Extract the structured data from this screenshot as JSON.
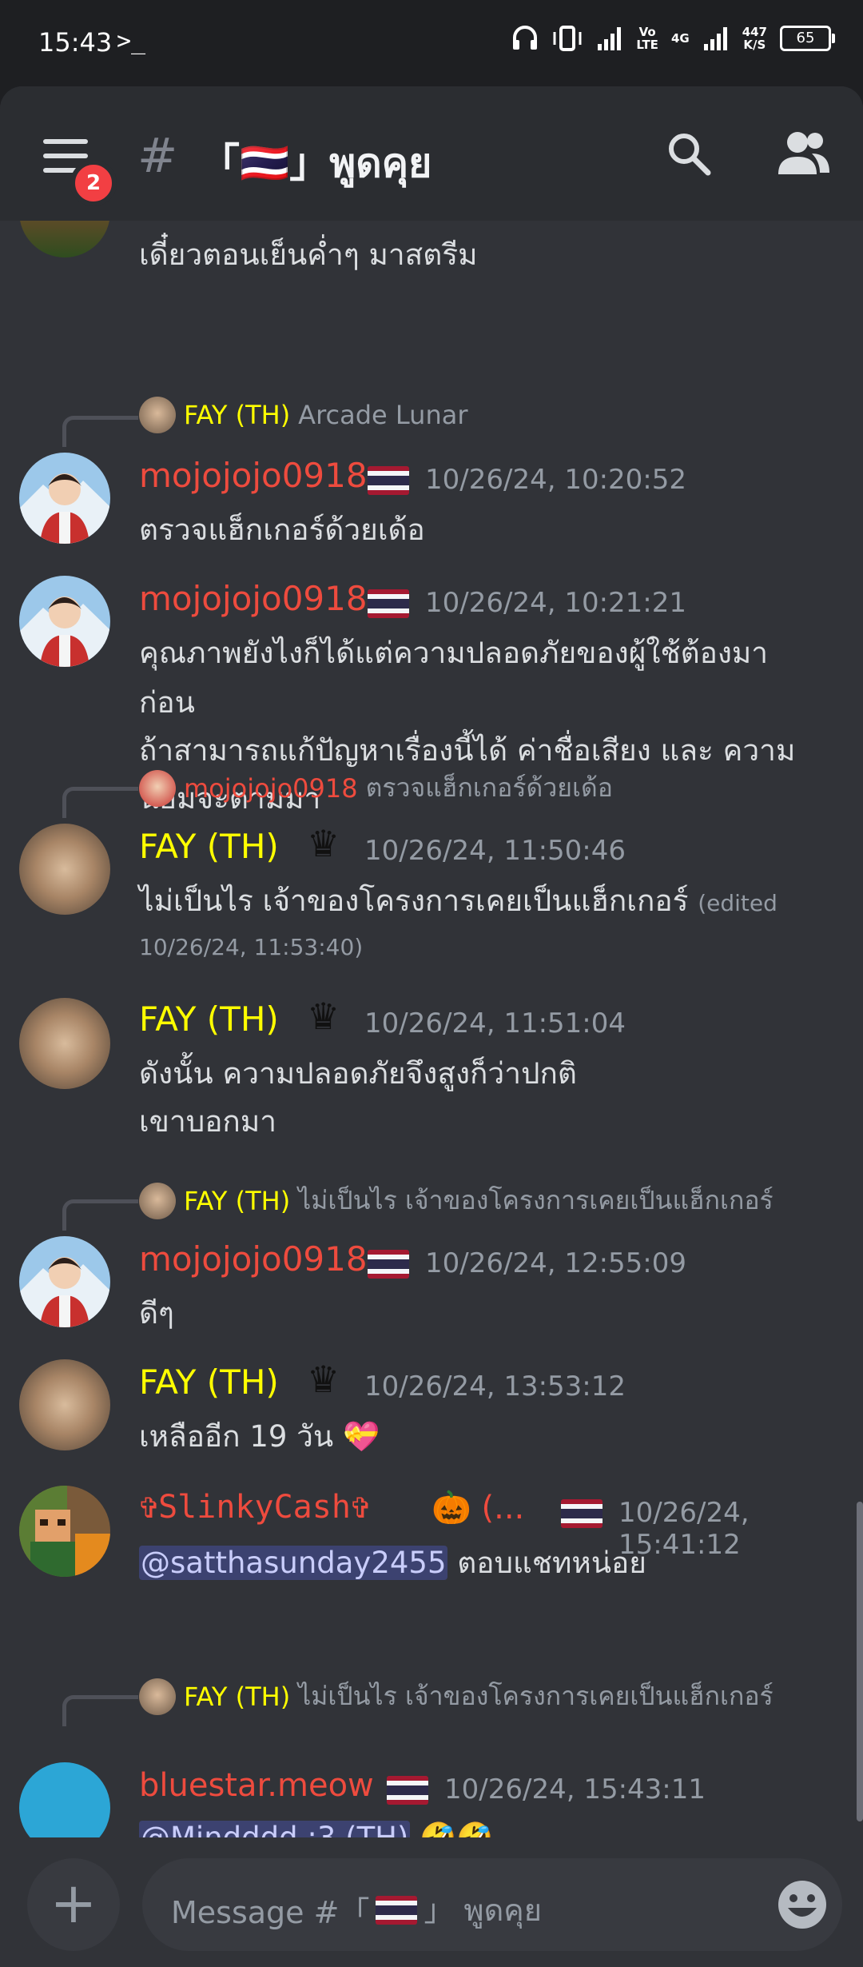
{
  "status_bar": {
    "time": "15:43",
    "terminal_glyph": ">_",
    "network_top": "Vo",
    "network_bottom": "LTE",
    "cell_type": "4G",
    "speed_top": "447",
    "speed_bottom": "K/S",
    "battery": "65"
  },
  "header": {
    "hamburger_badge": "2",
    "hash": "#",
    "channel_name": "「🇹🇭」พูดคุย"
  },
  "messages": {
    "top_partial_text": "เดี๋ยวตอนเย็นค่ำๆ มาสตรีม",
    "m1": {
      "reply_user": "FAY (TH)",
      "reply_text": "Arcade Lunar",
      "user": "mojojojo0918",
      "time": "10/26/24, 10:20:52",
      "text": "ตรวจแฮ็กเกอร์ด้วยเด้อ"
    },
    "m2": {
      "user": "mojojojo0918",
      "time": "10/26/24, 10:21:21",
      "line1": "คุณภาพยังไงก็ได้แต่ความปลอดภัยของผู้ใช้ต้องมา",
      "line2": "ก่อน",
      "line3": "ถ้าสามารถแก้ปัญหาเรื่องนี้ได้ ค่าชื่อเสียง และ ความ",
      "line4": "นิยมจะตามมา"
    },
    "m3": {
      "reply_user": "mojojojo0918",
      "reply_text": "ตรวจแฮ็กเกอร์ด้วยเด้อ",
      "user": "FAY (TH)",
      "crown": "♛",
      "time": "10/26/24, 11:50:46",
      "text": "ไม่เป็นไร เจ้าของโครงการเคยเป็นแฮ็กเกอร์",
      "edited_a": "(edited",
      "edited_b": "10/26/24, 11:53:40)"
    },
    "m4": {
      "user": "FAY (TH)",
      "crown": "♛",
      "time": "10/26/24, 11:51:04",
      "line1": "ดังนั้น ความปลอดภัยจึงสูงก็ว่าปกติ",
      "line2": "เขาบอกมา"
    },
    "m5": {
      "reply_user": "FAY (TH)",
      "reply_text": "ไม่เป็นไร เจ้าของโครงการเคยเป็นแฮ็กเกอร์",
      "user": "mojojojo0918",
      "time": "10/26/24, 12:55:09",
      "text": "ดีๆ"
    },
    "m6": {
      "user": "FAY (TH)",
      "crown": "♛",
      "time": "10/26/24, 13:53:12",
      "text": "เหลืออีก 19 วัน",
      "emoji": "💝"
    },
    "m7": {
      "user": "✞SlinkyCash✞",
      "user_extra": "🎃 (...",
      "time": "10/26/24, 15:41:12",
      "mention": "@satthasunday2455",
      "text": "ตอบแชทหน่อย"
    },
    "m8": {
      "reply_user": "FAY (TH)",
      "reply_text": "ไม่เป็นไร เจ้าของโครงการเคยเป็นแฮ็กเกอร์",
      "user": "bluestar.meow",
      "time": "10/26/24, 15:43:11",
      "mention": "@Mindddd :3 (TH)",
      "emoji": "🤣🤣"
    }
  },
  "input": {
    "plus": "+",
    "placeholder_prefix": "Message #「",
    "placeholder_suffix": "」 พูดคุย"
  },
  "colors": {
    "background": "#313338",
    "header": "#2b2d31",
    "username_red": "#ee4b3e",
    "username_yellow": "#ffff00",
    "timestamp": "#949ba4",
    "mention_bg": "#3c4270",
    "badge": "#f23f43"
  }
}
